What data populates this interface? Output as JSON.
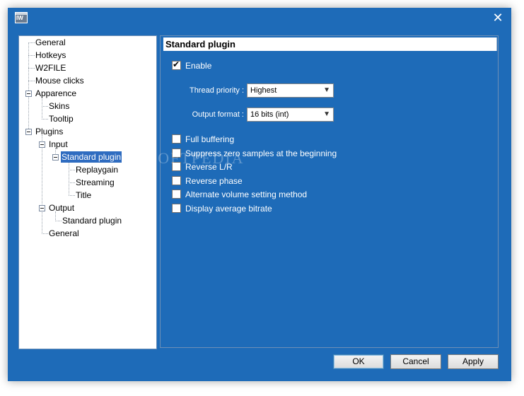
{
  "window": {
    "close_glyph": "✕"
  },
  "tree": {
    "general": "General",
    "hotkeys": "Hotkeys",
    "w2file": "W2FILE",
    "mouse_clicks": "Mouse clicks",
    "apparence": "Apparence",
    "skins": "Skins",
    "tooltip": "Tooltip",
    "plugins": "Plugins",
    "input": "Input",
    "standard_plugin_input": "Standard plugin",
    "replaygain": "Replaygain",
    "streaming": "Streaming",
    "title": "Title",
    "output": "Output",
    "standard_plugin_output": "Standard plugin",
    "general_plugins": "General"
  },
  "panel": {
    "header": "Standard plugin",
    "enable_label": "Enable",
    "enable_checked": true,
    "thread_priority_label": "Thread priority :",
    "thread_priority_value": "Highest",
    "output_format_label": "Output format :",
    "output_format_value": "16 bits (int)",
    "options": [
      {
        "label": "Full buffering",
        "checked": false
      },
      {
        "label": "Suppress zero samples at the beginning",
        "checked": false
      },
      {
        "label": "Reverse L/R",
        "checked": false
      },
      {
        "label": "Reverse phase",
        "checked": false
      },
      {
        "label": "Alternate volume setting method",
        "checked": false
      },
      {
        "label": "Display average bitrate",
        "checked": false
      }
    ]
  },
  "buttons": {
    "ok": "OK",
    "cancel": "Cancel",
    "apply": "Apply"
  },
  "watermark": "SOFTPEDIA"
}
